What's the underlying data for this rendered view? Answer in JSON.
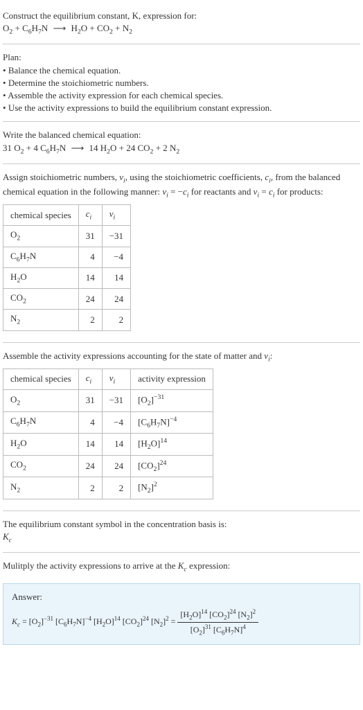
{
  "intro": {
    "line1": "Construct the equilibrium constant, K, expression for:",
    "eq_unbalanced_html": "O<sub>2</sub> + C<sub>6</sub>H<sub>7</sub>N <span class='arrow'>⟶</span> H<sub>2</sub>O + CO<sub>2</sub> + N<sub>2</sub>"
  },
  "plan": {
    "heading": "Plan:",
    "items": [
      "Balance the chemical equation.",
      "Determine the stoichiometric numbers.",
      "Assemble the activity expression for each chemical species.",
      "Use the activity expressions to build the equilibrium constant expression."
    ]
  },
  "balanced": {
    "heading": "Write the balanced chemical equation:",
    "eq_html": "31 O<sub>2</sub> + 4 C<sub>6</sub>H<sub>7</sub>N <span class='arrow'>⟶</span> 14 H<sub>2</sub>O + 24 CO<sub>2</sub> + 2 N<sub>2</sub>"
  },
  "stoich": {
    "heading_html": "Assign stoichiometric numbers, <span class='ital'>ν<sub>i</sub></span>, using the stoichiometric coefficients, <span class='ital'>c<sub>i</sub></span>, from the balanced chemical equation in the following manner: <span class='ital'>ν<sub>i</sub></span> = −<span class='ital'>c<sub>i</sub></span> for reactants and <span class='ital'>ν<sub>i</sub></span> = <span class='ital'>c<sub>i</sub></span> for products:",
    "cols": {
      "species": "chemical species",
      "ci_html": "<span class='ital'>c<sub>i</sub></span>",
      "vi_html": "<span class='ital'>ν<sub>i</sub></span>"
    },
    "rows": [
      {
        "species_html": "O<sub>2</sub>",
        "ci": "31",
        "vi": "−31"
      },
      {
        "species_html": "C<sub>6</sub>H<sub>7</sub>N",
        "ci": "4",
        "vi": "−4"
      },
      {
        "species_html": "H<sub>2</sub>O",
        "ci": "14",
        "vi": "14"
      },
      {
        "species_html": "CO<sub>2</sub>",
        "ci": "24",
        "vi": "24"
      },
      {
        "species_html": "N<sub>2</sub>",
        "ci": "2",
        "vi": "2"
      }
    ]
  },
  "activity": {
    "heading_html": "Assemble the activity expressions accounting for the state of matter and <span class='ital'>ν<sub>i</sub></span>:",
    "cols": {
      "species": "chemical species",
      "ci_html": "<span class='ital'>c<sub>i</sub></span>",
      "vi_html": "<span class='ital'>ν<sub>i</sub></span>",
      "act": "activity expression"
    },
    "rows": [
      {
        "species_html": "O<sub>2</sub>",
        "ci": "31",
        "vi": "−31",
        "act_html": "[O<sub>2</sub>]<sup>−31</sup>"
      },
      {
        "species_html": "C<sub>6</sub>H<sub>7</sub>N",
        "ci": "4",
        "vi": "−4",
        "act_html": "[C<sub>6</sub>H<sub>7</sub>N]<sup>−4</sup>"
      },
      {
        "species_html": "H<sub>2</sub>O",
        "ci": "14",
        "vi": "14",
        "act_html": "[H<sub>2</sub>O]<sup>14</sup>"
      },
      {
        "species_html": "CO<sub>2</sub>",
        "ci": "24",
        "vi": "24",
        "act_html": "[CO<sub>2</sub>]<sup>24</sup>"
      },
      {
        "species_html": "N<sub>2</sub>",
        "ci": "2",
        "vi": "2",
        "act_html": "[N<sub>2</sub>]<sup>2</sup>"
      }
    ]
  },
  "kc_symbol": {
    "heading": "The equilibrium constant symbol in the concentration basis is:",
    "symbol_html": "<span class='ital'>K<sub>c</sub></span>"
  },
  "multiply": {
    "heading_html": "Mulitply the activity expressions to arrive at the <span class='ital'>K<sub>c</sub></span> expression:"
  },
  "answer": {
    "label": "Answer:",
    "lhs_html": "<span class='ital'>K<sub>c</sub></span> = [O<sub>2</sub>]<sup>−31</sup> [C<sub>6</sub>H<sub>7</sub>N]<sup>−4</sup> [H<sub>2</sub>O]<sup>14</sup> [CO<sub>2</sub>]<sup>24</sup> [N<sub>2</sub>]<sup>2</sup> = ",
    "frac_num_html": "[H<sub>2</sub>O]<sup>14</sup> [CO<sub>2</sub>]<sup>24</sup> [N<sub>2</sub>]<sup>2</sup>",
    "frac_den_html": "[O<sub>2</sub>]<sup>31</sup> [C<sub>6</sub>H<sub>7</sub>N]<sup>4</sup>"
  }
}
